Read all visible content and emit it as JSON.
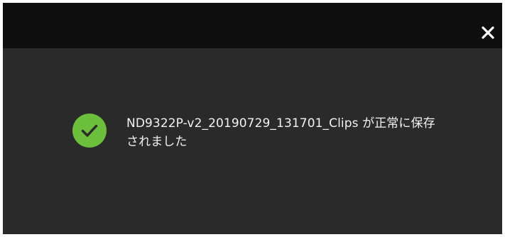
{
  "dialog": {
    "close_icon": "close-icon",
    "status_icon": "check-circle-icon",
    "message": "ND9322P-v2_20190729_131701_Clips が正常に保存されました"
  },
  "colors": {
    "titlebar": "#0f0f0f",
    "body": "#2a2a2a",
    "success": "#6cbf3b",
    "text": "#f2f2f2"
  }
}
